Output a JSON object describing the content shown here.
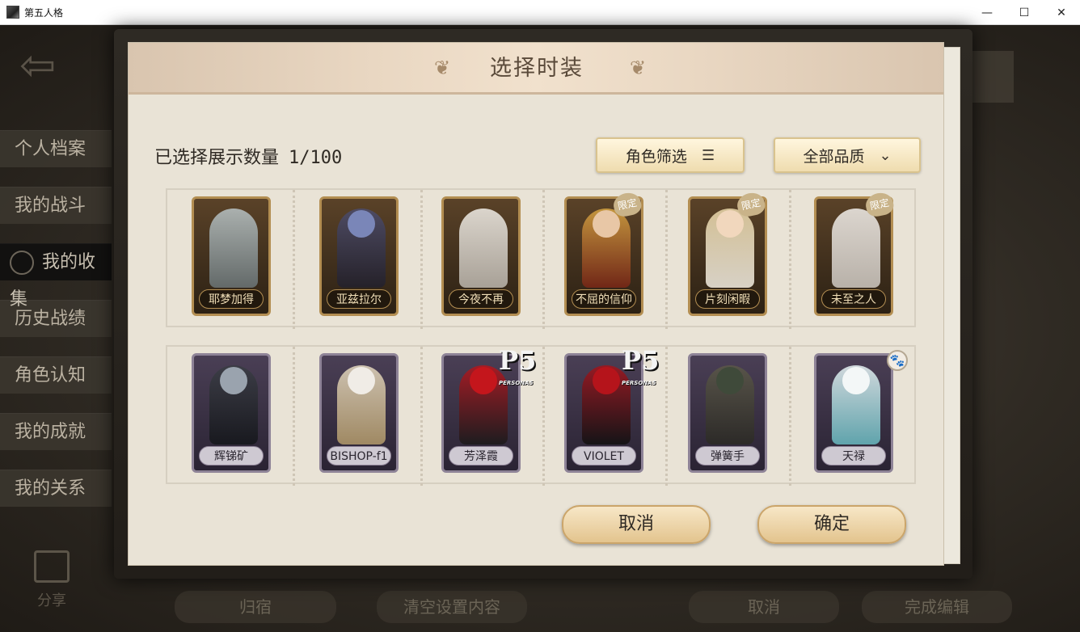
{
  "window": {
    "title": "第五人格",
    "minimize": "—",
    "maximize": "☐",
    "close": "✕"
  },
  "background": {
    "back_icon": "⇦",
    "side_menu": [
      {
        "label": "个人档案",
        "active": false
      },
      {
        "label": "我的战斗",
        "active": false
      },
      {
        "label": "我的收集",
        "active": true
      },
      {
        "label": "历史战绩",
        "active": false
      },
      {
        "label": "角色认知",
        "active": false
      },
      {
        "label": "我的成就",
        "active": false
      },
      {
        "label": "我的关系",
        "active": false
      }
    ],
    "share_label": "分享",
    "bottom_buttons": [
      "归宿",
      "清空设置内容",
      "取消",
      "完成编辑"
    ]
  },
  "dialog": {
    "title": "选择时装",
    "leaf_glyph": "❦",
    "count_label": "已选择展示数量",
    "count_value": "1/100",
    "role_filter_label": "角色筛选",
    "role_filter_icon": "☰",
    "quality_filter_label": "全部品质",
    "quality_filter_icon": "⌄",
    "rows": [
      [
        {
          "name": "耶梦加得",
          "frame": "gold",
          "badge": ""
        },
        {
          "name": "亚兹拉尔",
          "frame": "gold",
          "badge": ""
        },
        {
          "name": "今夜不再",
          "frame": "gold",
          "badge": ""
        },
        {
          "name": "不屈的信仰",
          "frame": "gold",
          "badge": "限定"
        },
        {
          "name": "片刻闲暇",
          "frame": "gold",
          "badge": "限定"
        },
        {
          "name": "未至之人",
          "frame": "gold",
          "badge": "限定"
        }
      ],
      [
        {
          "name": "辉锑矿",
          "frame": "purple",
          "badge": ""
        },
        {
          "name": "BISHOP-f1",
          "frame": "purple",
          "badge": ""
        },
        {
          "name": "芳泽霞",
          "frame": "purple",
          "badge": "P5"
        },
        {
          "name": "VIOLET",
          "frame": "purple",
          "badge": "P5"
        },
        {
          "name": "弹簧手",
          "frame": "purple",
          "badge": ""
        },
        {
          "name": "天禄",
          "frame": "purple",
          "badge": "paw"
        }
      ]
    ],
    "p5_badge_text": "P5",
    "p5_badge_sub": "PERSONA5",
    "paw_glyph": "🐾",
    "cancel_label": "取消",
    "confirm_label": "确定"
  },
  "colors": {
    "gold_frame": "#b38e52",
    "purple_frame": "#8e8397",
    "limited_badge": "#c9b389",
    "button_fill": "#e3c48e"
  }
}
